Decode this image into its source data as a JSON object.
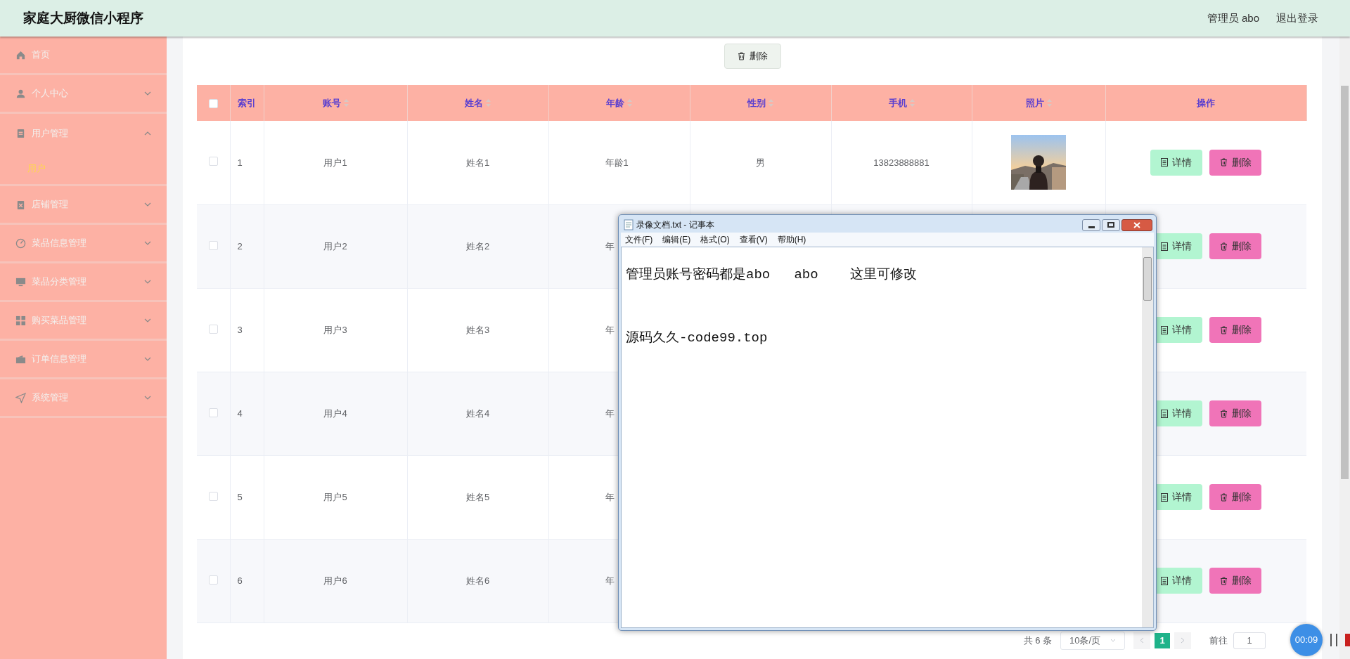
{
  "header": {
    "title": "家庭大厨微信小程序",
    "user": "管理员 abo",
    "logout": "退出登录"
  },
  "sidebar": {
    "items": [
      {
        "label": "首页",
        "kind": "link"
      },
      {
        "label": "个人中心",
        "kind": "menu",
        "expanded": false
      },
      {
        "label": "用户管理",
        "kind": "menu",
        "expanded": true,
        "children": [
          {
            "label": "用户",
            "selected": true
          }
        ]
      },
      {
        "label": "店铺管理",
        "kind": "menu",
        "expanded": false
      },
      {
        "label": "菜品信息管理",
        "kind": "menu",
        "expanded": false
      },
      {
        "label": "菜品分类管理",
        "kind": "menu",
        "expanded": false
      },
      {
        "label": "购买菜品管理",
        "kind": "menu",
        "expanded": false
      },
      {
        "label": "订单信息管理",
        "kind": "menu",
        "expanded": false
      },
      {
        "label": "系统管理",
        "kind": "menu",
        "expanded": false
      }
    ]
  },
  "toolbar": {
    "delete_button": "删除"
  },
  "table": {
    "select_all": {
      "checked": false
    },
    "columns": [
      {
        "label": "索引",
        "sortable": false
      },
      {
        "label": "账号",
        "sortable": true
      },
      {
        "label": "姓名",
        "sortable": true
      },
      {
        "label": "年龄",
        "sortable": true
      },
      {
        "label": "性别",
        "sortable": true
      },
      {
        "label": "手机",
        "sortable": true
      },
      {
        "label": "照片",
        "sortable": true
      },
      {
        "label": "操作",
        "sortable": false
      }
    ],
    "rows": [
      {
        "checked": false,
        "index": "1",
        "account": "用户1",
        "name": "姓名1",
        "age": "年龄1",
        "gender": "男",
        "phone": "13823888881",
        "actions": [
          {
            "label": "详情",
            "kind": "detail"
          },
          {
            "label": "删除",
            "kind": "delete"
          }
        ]
      },
      {
        "checked": false,
        "index": "2",
        "account": "用户2",
        "name": "姓名2",
        "age": "年",
        "actions": [
          {
            "label": "详情",
            "kind": "detail"
          },
          {
            "label": "删除",
            "kind": "delete"
          }
        ]
      },
      {
        "checked": false,
        "index": "3",
        "account": "用户3",
        "name": "姓名3",
        "age": "年",
        "actions": [
          {
            "label": "详情",
            "kind": "detail"
          },
          {
            "label": "删除",
            "kind": "delete"
          }
        ]
      },
      {
        "checked": false,
        "index": "4",
        "account": "用户4",
        "name": "姓名4",
        "age": "年",
        "actions": [
          {
            "label": "详情",
            "kind": "detail"
          },
          {
            "label": "删除",
            "kind": "delete"
          }
        ]
      },
      {
        "checked": false,
        "index": "5",
        "account": "用户5",
        "name": "姓名5",
        "age": "年",
        "actions": [
          {
            "label": "详情",
            "kind": "detail"
          },
          {
            "label": "删除",
            "kind": "delete"
          }
        ]
      },
      {
        "checked": false,
        "index": "6",
        "account": "用户6",
        "name": "姓名6",
        "age": "年",
        "actions": [
          {
            "label": "详情",
            "kind": "detail"
          },
          {
            "label": "删除",
            "kind": "delete"
          }
        ]
      }
    ]
  },
  "pagination": {
    "total": "共 6 条",
    "page_size": "10条/页",
    "pages": [
      {
        "label": "1",
        "selected": true
      }
    ],
    "goto_label": "前往",
    "goto_value": "1"
  },
  "notepad": {
    "title": "录像文档.txt - 记事本",
    "menu": [
      "文件(F)",
      "编辑(E)",
      "格式(O)",
      "查看(V)",
      "帮助(H)"
    ],
    "lines": [
      "管理员账号密码都是abo   abo    这里可修改",
      "源码久久-code99.top"
    ]
  },
  "recorder": {
    "time": "00:09"
  }
}
